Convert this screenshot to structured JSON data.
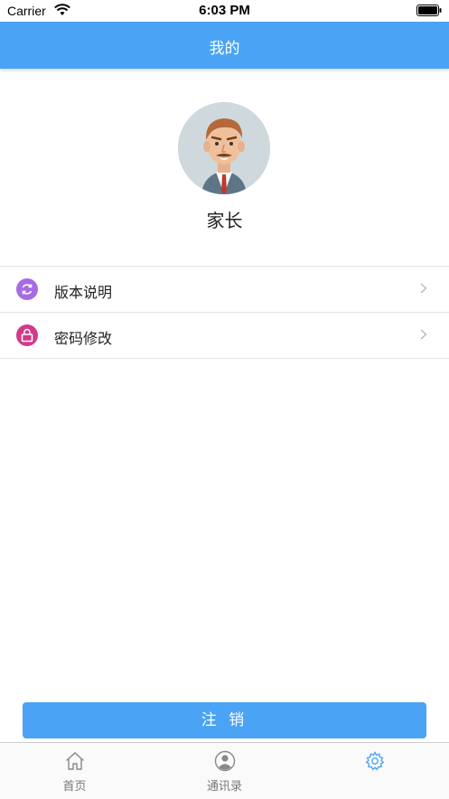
{
  "status_bar": {
    "carrier": "Carrier",
    "time": "6:03 PM"
  },
  "header": {
    "title": "我的"
  },
  "profile": {
    "name": "家长"
  },
  "menu": {
    "items": [
      {
        "label": "版本说明",
        "icon": "refresh-icon",
        "color": "#a76be4"
      },
      {
        "label": "密码修改",
        "icon": "lock-icon",
        "color": "#d13b8a"
      }
    ]
  },
  "logout_button": {
    "label": "注 销"
  },
  "tabbar": {
    "items": [
      {
        "label": "首页",
        "icon": "home-icon"
      },
      {
        "label": "通讯录",
        "icon": "contacts-icon"
      },
      {
        "label": "",
        "icon": "settings-icon"
      }
    ],
    "active_color": "#4aa3f4"
  },
  "colors": {
    "primary": "#4aa3f4"
  }
}
